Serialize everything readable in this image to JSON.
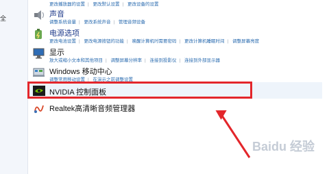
{
  "left_pane": {
    "text": "全"
  },
  "items": [
    {
      "title": "",
      "links": [
        "更改播放器的设置",
        "更改默认设置",
        "更改设备的设置"
      ]
    },
    {
      "title": "声音",
      "links": [
        "调整系统音量",
        "更改系统声音",
        "管理音频设备"
      ]
    },
    {
      "title": "电源选项",
      "links": [
        "更改电池设置",
        "更改电源按钮的功能",
        "唤醒计算机时需要密码",
        "更改计算机睡眠时间",
        "调整屏幕亮度"
      ]
    },
    {
      "title": "显示",
      "links": [
        "放大或缩小文本和其他项目",
        "调整屏幕分辨率",
        "连接到投影仪",
        "连接到外部显示器"
      ]
    },
    {
      "title": "Windows 移动中心",
      "links": [
        "调整常用移动设置",
        "在演示之前调整设置"
      ]
    },
    {
      "title": "NVIDIA 控制面板",
      "links": []
    },
    {
      "title": "Realtek高清晰音频管理器",
      "links": []
    }
  ],
  "colors": {
    "highlight_border": "#e3262b",
    "arrow": "#e3262b",
    "link": "#2b6cb0"
  },
  "watermark": "Baidu 经验"
}
